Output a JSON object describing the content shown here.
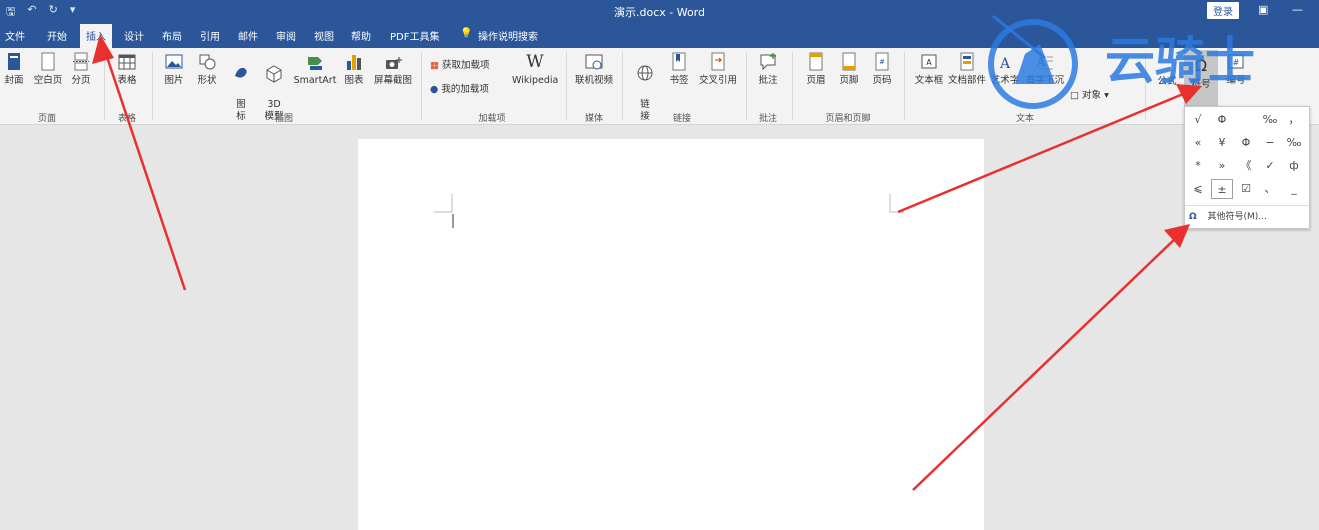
{
  "window": {
    "title": "演示.docx - Word",
    "login_label": "登录"
  },
  "tabs": [
    "文件",
    "开始",
    "插入",
    "设计",
    "布局",
    "引用",
    "邮件",
    "审阅",
    "视图",
    "帮助",
    "PDF工具集",
    "操作说明搜索"
  ],
  "ribbon": {
    "buttons": {
      "cover": "封面",
      "blank": "空白页",
      "pagebreak": "分页",
      "table": "表格",
      "picture": "图片",
      "shapes": "形状",
      "icons": "图\n标",
      "model3d": "3D\n模型",
      "smartart": "SmartArt",
      "chart": "图表",
      "screenshot": "屏幕截图",
      "get_addins": "获取加载项",
      "my_addins": "我的加载项",
      "wikipedia": "Wikipedia",
      "online_video": "联机视频",
      "link": "链\n接",
      "bookmark": "书签",
      "crossref": "交叉引用",
      "comment": "批注",
      "header": "页眉",
      "footer": "页脚",
      "pagenum": "页码",
      "textbox": "文本框",
      "quickparts": "文档部件",
      "wordart": "艺术字",
      "dropcap": "首字下沉",
      "object": "对象",
      "equation": "公式",
      "symbol": "符号",
      "number": "编号"
    },
    "groups": {
      "pages": "页面",
      "tables": "表格",
      "illustrations": "插图",
      "addins": "加载项",
      "media": "媒体",
      "links": "链接",
      "comments": "批注",
      "header_footer": "页眉和页脚",
      "text": "文本"
    }
  },
  "symbols_panel": {
    "symbols": [
      "√",
      "Φ",
      "",
      "‰",
      "，",
      "«",
      "¥",
      "Φ",
      "−",
      "‰",
      "*",
      "»",
      "《",
      "✓",
      "ф",
      "⩽",
      "±",
      "☑",
      "、",
      "_"
    ],
    "more_label": "其他符号(M)..."
  },
  "watermark": {
    "text": "云骑士"
  },
  "colors": {
    "accent": "#2b579a",
    "arrow": "#e8312f"
  }
}
